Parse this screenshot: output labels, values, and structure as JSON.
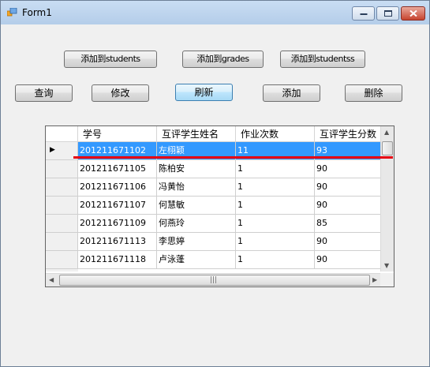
{
  "window": {
    "title": "Form1"
  },
  "buttons_top": [
    {
      "label": "添加到students"
    },
    {
      "label": "添加到grades"
    },
    {
      "label": "添加到studentss"
    }
  ],
  "buttons_row": [
    {
      "label": "查询"
    },
    {
      "label": "修改"
    },
    {
      "label": "刷新"
    },
    {
      "label": "添加"
    },
    {
      "label": "删除"
    }
  ],
  "grid": {
    "columns": [
      "学号",
      "互评学生姓名",
      "作业次数",
      "互评学生分数"
    ],
    "rows": [
      [
        "201211671102",
        "左栩颖",
        "11",
        "93"
      ],
      [
        "201211671105",
        "陈柏安",
        "1",
        "90"
      ],
      [
        "201211671106",
        "冯黄怡",
        "1",
        "90"
      ],
      [
        "201211671107",
        "何慧敏",
        "1",
        "90"
      ],
      [
        "201211671109",
        "何燕玲",
        "1",
        "85"
      ],
      [
        "201211671113",
        "李思婷",
        "1",
        "90"
      ],
      [
        "201211671118",
        "卢泳蓬",
        "1",
        "90"
      ]
    ],
    "selected_row": 0,
    "row_indicator_icon": "current-row-triangle-icon",
    "annotation_color": "#e60012",
    "selection_color": "#3399ff"
  }
}
